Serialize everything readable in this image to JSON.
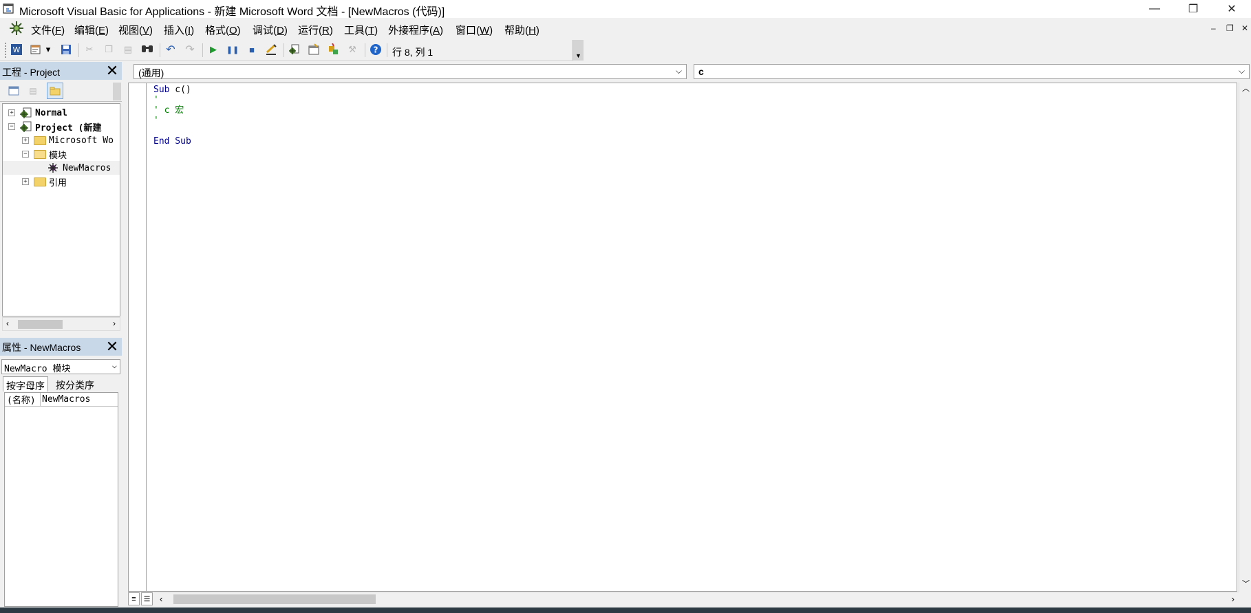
{
  "window": {
    "title": "Microsoft Visual Basic for Applications - 新建 Microsoft Word 文档 - [NewMacros (代码)]",
    "minimize": "—",
    "restore": "❐",
    "close": "✕"
  },
  "menu": [
    {
      "label": "文件(",
      "key": "F",
      "end": ")"
    },
    {
      "label": "编辑(",
      "key": "E",
      "end": ")"
    },
    {
      "label": "视图(",
      "key": "V",
      "end": ")"
    },
    {
      "label": "插入(",
      "key": "I",
      "end": ")"
    },
    {
      "label": "格式(",
      "key": "O",
      "end": ")"
    },
    {
      "label": "调试(",
      "key": "D",
      "end": ")"
    },
    {
      "label": "运行(",
      "key": "R",
      "end": ")"
    },
    {
      "label": "工具(",
      "key": "T",
      "end": ")"
    },
    {
      "label": "外接程序(",
      "key": "A",
      "end": ")"
    },
    {
      "label": "窗口(",
      "key": "W",
      "end": ")"
    },
    {
      "label": "帮助(",
      "key": "H",
      "end": ")"
    }
  ],
  "toolbar": {
    "position": "行 8, 列 1",
    "icons": [
      "word-view-icon",
      "insert-module-icon",
      "save-icon",
      "cut-icon",
      "copy-icon",
      "paste-icon",
      "find-icon",
      "undo-icon",
      "redo-icon",
      "run-icon",
      "break-icon",
      "reset-icon",
      "design-mode-icon",
      "project-explorer-icon",
      "properties-window-icon",
      "object-browser-icon",
      "toolbox-icon",
      "help-icon"
    ]
  },
  "project": {
    "title": "工程 - Project",
    "tree": {
      "normal": "Normal",
      "project": "Project (新建",
      "word_objects": "Microsoft Wo",
      "modules": "模块",
      "newmacros": "NewMacros",
      "references": "引用"
    }
  },
  "properties": {
    "title": "属性 - NewMacros",
    "object": "NewMacro 模块",
    "tab_alpha": "按字母序",
    "tab_category": "按分类序",
    "row_key": "(名称)",
    "row_value": "NewMacros"
  },
  "code": {
    "proc_left": "(通用)",
    "proc_right": "c",
    "lines": {
      "l1_kw": "Sub",
      "l1_rest": " c()",
      "l2": "'",
      "l3": "' c 宏",
      "l4": "'",
      "l6": "End Sub"
    }
  }
}
